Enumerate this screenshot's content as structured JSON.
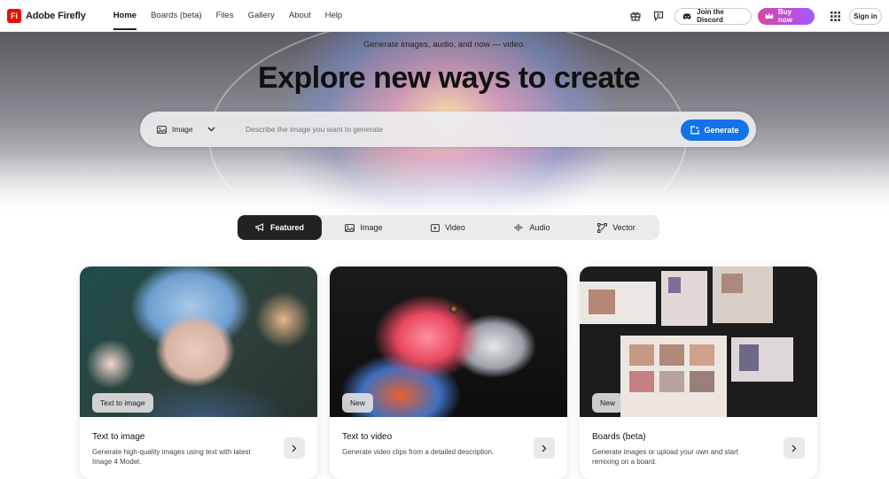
{
  "header": {
    "brand": "Adobe Firefly",
    "logo_text": "Fi",
    "nav": [
      {
        "label": "Home",
        "active": true
      },
      {
        "label": "Boards (beta)",
        "active": false
      },
      {
        "label": "Files",
        "active": false
      },
      {
        "label": "Gallery",
        "active": false
      },
      {
        "label": "About",
        "active": false
      },
      {
        "label": "Help",
        "active": false
      }
    ],
    "discord_label": "Join the Discord",
    "buy_label": "Buy now",
    "signin_label": "Sign in"
  },
  "hero": {
    "tagline": "Generate images, audio, and now — video.",
    "title": "Explore new ways to create",
    "type_selected": "Image",
    "prompt_placeholder": "Describe the image you want to generate",
    "generate_label": "Generate"
  },
  "tabs": [
    {
      "label": "Featured",
      "icon": "megaphone-icon",
      "active": true
    },
    {
      "label": "Image",
      "icon": "image-icon",
      "active": false
    },
    {
      "label": "Video",
      "icon": "video-icon",
      "active": false
    },
    {
      "label": "Audio",
      "icon": "audio-wave-icon",
      "active": false
    },
    {
      "label": "Vector",
      "icon": "vector-icon",
      "active": false
    }
  ],
  "cards": [
    {
      "badge": "Text to image",
      "title": "Text to image",
      "desc": "Generate high-quality images using text with latest Image 4 Model."
    },
    {
      "badge": "New",
      "title": "Text to video",
      "desc": "Generate video clips from a detailed description."
    },
    {
      "badge": "New",
      "title": "Boards (beta)",
      "desc": "Generate images or upload your own and start remixing on a board."
    }
  ],
  "colors": {
    "accent": "#1473e6",
    "brand": "#eb1000",
    "active_tab": "#222222"
  }
}
